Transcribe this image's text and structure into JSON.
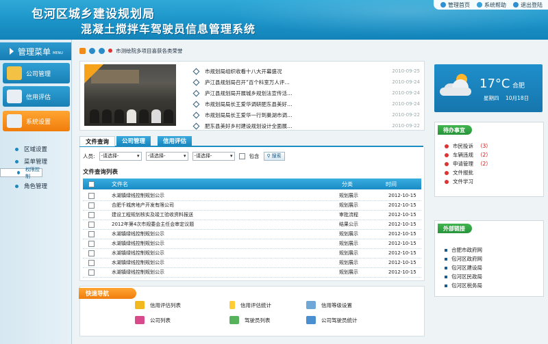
{
  "header": {
    "title_line1": "包河区城乡建设规划局",
    "title_line2": "混凝土搅拌车驾驶员信息管理系统",
    "links": [
      {
        "label": "管理首页",
        "icon": "home-icon"
      },
      {
        "label": "系统帮助",
        "icon": "help-icon"
      },
      {
        "label": "退出登陆",
        "icon": "logout-icon"
      }
    ]
  },
  "sidebar": {
    "title": "管理菜单",
    "title_sub": "MENU",
    "items": [
      {
        "label": "公司管理",
        "icon": "building-icon",
        "active": false
      },
      {
        "label": "信用评估",
        "icon": "id-card-icon",
        "active": false
      },
      {
        "label": "系统设置",
        "icon": "settings-icon",
        "active": true
      }
    ],
    "subitems": [
      {
        "label": "区域设置"
      },
      {
        "label": "菜单管理"
      },
      {
        "label": "权限控制",
        "selected": true
      },
      {
        "label": "角色管理"
      }
    ]
  },
  "breadcrumb": {
    "text": "市测绘院多项目喜获各类荣誉"
  },
  "news": {
    "items": [
      {
        "title": "市规划局组织收看十八大开幕盛况",
        "date": "2010-09-25"
      },
      {
        "title": "庐江县规划局召开“百个科室万人评…",
        "date": "2010-09-24"
      },
      {
        "title": "庐江县规划局开展城乡规划法宣传活…",
        "date": "2010-09-24"
      },
      {
        "title": "市规划局局长王爱华调研肥东县美好…",
        "date": "2010-09-24"
      },
      {
        "title": "市规划局局长王爱华一行到巢湖市调…",
        "date": "2010-09-22"
      },
      {
        "title": "肥东县美好乡村建设规划设计全面展…",
        "date": "2010-09-22"
      }
    ]
  },
  "tabs": [
    {
      "label": "文件查询",
      "active": true
    },
    {
      "label": "公司管理",
      "active": false
    },
    {
      "label": "信用评估",
      "active": false
    }
  ],
  "filters": {
    "label": "人员:",
    "selects": [
      "-请选择-",
      "-请选择-",
      "-请选择-"
    ],
    "checkbox_label": "包含",
    "search_label": "搜索"
  },
  "table": {
    "title": "文件查询列表",
    "headers": {
      "name": "文件名",
      "category": "分类",
      "time": "时间"
    },
    "rows": [
      {
        "name": "水湖镇绿线控制规划公示",
        "category": "规划展示",
        "time": "2012-10-15"
      },
      {
        "name": "合肥千城房地产开发有限公司",
        "category": "规划展示",
        "time": "2012-10-15"
      },
      {
        "name": "建设工程规划核实及竣工验收资料报送",
        "category": "审批流程",
        "time": "2012-10-15"
      },
      {
        "name": "2012年第4次市规委会主任会审定议题",
        "category": "结果公示",
        "time": "2012-10-15"
      },
      {
        "name": "水湖镇绿线控制规划公示",
        "category": "规划展示",
        "time": "2012-10-15"
      },
      {
        "name": "水湖镇绿线控制规划公示",
        "category": "规划展示",
        "time": "2012-10-15"
      },
      {
        "name": "水湖镇绿线控制规划公示",
        "category": "规划展示",
        "time": "2012-10-15"
      },
      {
        "name": "水湖镇绿线控制规划公示",
        "category": "规划展示",
        "time": "2012-10-15"
      },
      {
        "name": "水湖镇绿线控制规划公示",
        "category": "规划展示",
        "time": "2012-10-15"
      }
    ]
  },
  "quicknav": {
    "title": "快速导航",
    "items": [
      {
        "label": "信用评估列表",
        "icon": "envelope-icon",
        "color": "#f1b81f"
      },
      {
        "label": "信用评估统计",
        "icon": "bottle-icon",
        "color": "#ffcc33"
      },
      {
        "label": "信用等级设置",
        "icon": "window-icon",
        "color": "#6fa8d6"
      },
      {
        "label": "公司列表",
        "icon": "book-icon",
        "color": "#d84a8b"
      },
      {
        "label": "驾驶员列表",
        "icon": "tools-icon",
        "color": "#56b35c"
      },
      {
        "label": "公司驾驶员统计",
        "icon": "calendar-icon",
        "color": "#4a8fd0"
      }
    ]
  },
  "weather": {
    "temp": "17°C",
    "city": "合肥",
    "weekday": "星期四",
    "date": "10月18日"
  },
  "todo": {
    "title": "待办事宜",
    "items": [
      {
        "label": "市民投诉",
        "count": "（3）"
      },
      {
        "label": "车辆违规",
        "count": "（2）"
      },
      {
        "label": "申请管理",
        "count": "（2）"
      },
      {
        "label": "文件报批",
        "count": ""
      },
      {
        "label": "文件学习",
        "count": ""
      }
    ]
  },
  "links": {
    "title": "外部链接",
    "items": [
      "合肥市政府网",
      "包河区政府网",
      "包河区建设局",
      "包河区民政局",
      "包河区税务局"
    ]
  }
}
